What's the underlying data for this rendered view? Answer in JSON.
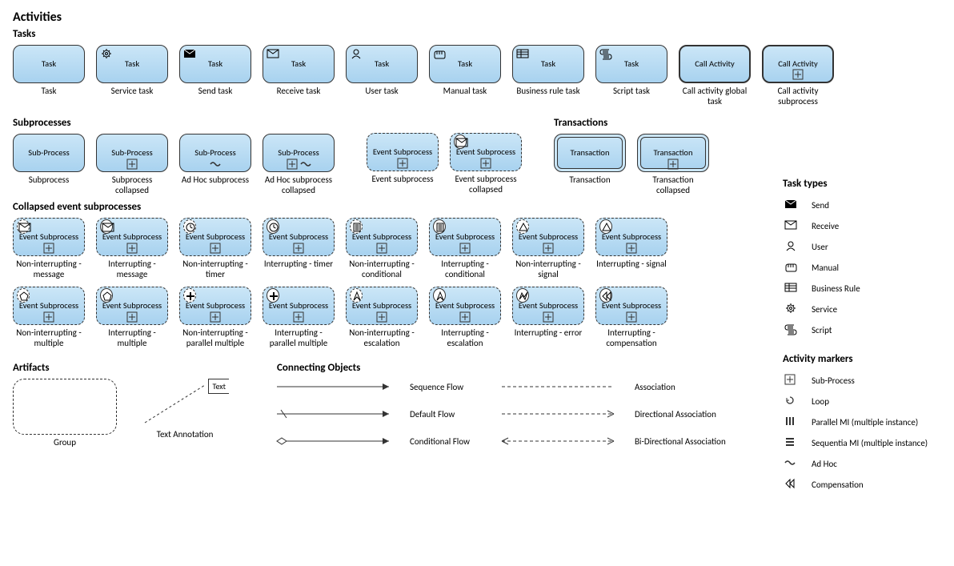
{
  "headings": {
    "activities": "Activities",
    "tasks": "Tasks",
    "subprocesses": "Subprocesses",
    "transactions": "Transactions",
    "collapsed": "Collapsed event subprocesses",
    "artifacts": "Artifacts",
    "connecting": "Connecting Objects",
    "task_types": "Task types",
    "activity_markers": "Activity markers"
  },
  "tasks": [
    {
      "label": "Task",
      "caption": "Task",
      "icon": null
    },
    {
      "label": "Task",
      "caption": "Service task",
      "icon": "gear"
    },
    {
      "label": "Task",
      "caption": "Send task",
      "icon": "send"
    },
    {
      "label": "Task",
      "caption": "Receive task",
      "icon": "receive"
    },
    {
      "label": "Task",
      "caption": "User task",
      "icon": "user"
    },
    {
      "label": "Task",
      "caption": "Manual task",
      "icon": "manual"
    },
    {
      "label": "Task",
      "caption": "Business rule task",
      "icon": "rule"
    },
    {
      "label": "Task",
      "caption": "Script task",
      "icon": "script"
    },
    {
      "label": "Call Activity",
      "caption": "Call activity global task",
      "icon": null,
      "thick": true
    },
    {
      "label": "Call Activity",
      "caption": "Call activity subprocess",
      "icon": null,
      "thick": true,
      "markers": [
        "plusbox"
      ]
    }
  ],
  "subprocesses": [
    {
      "label": "Sub-Process",
      "caption": "Subprocess"
    },
    {
      "label": "Sub-Process",
      "caption": "Subprocess collapsed",
      "markers": [
        "plusbox"
      ]
    },
    {
      "label": "Sub-Process",
      "caption": "Ad Hoc subprocess",
      "markers": [
        "tilde"
      ]
    },
    {
      "label": "Sub-Process",
      "caption": "Ad Hoc subprocess collapsed",
      "markers": [
        "plusbox",
        "tilde"
      ]
    }
  ],
  "event_subprocesses": [
    {
      "label": "Event Subprocess",
      "caption": "Event subprocess",
      "dashed": true,
      "markers": [
        "plusbox"
      ]
    },
    {
      "label": "Event Subprocess",
      "caption": "Event subprocess collapsed",
      "dashed": true,
      "markers": [
        "plusbox"
      ],
      "corner": {
        "shape": "receive",
        "circle": "solid"
      }
    }
  ],
  "transactions": [
    {
      "label": "Transaction",
      "caption": "Transaction",
      "double": true
    },
    {
      "label": "Transaction",
      "caption": "Transaction collapsed",
      "double": true,
      "markers": [
        "plusbox"
      ]
    }
  ],
  "collapsed_rows": [
    [
      {
        "caption": "Non-interrupting - message",
        "corner": {
          "shape": "receive",
          "circle": "dashed"
        }
      },
      {
        "caption": "Interrupting - message",
        "corner": {
          "shape": "receive",
          "circle": "solid"
        }
      },
      {
        "caption": "Non-interrupting - timer",
        "corner": {
          "shape": "clock",
          "circle": "dashed"
        }
      },
      {
        "caption": "Interrupting - timer",
        "corner": {
          "shape": "clock",
          "circle": "solid"
        }
      },
      {
        "caption": "Non-interrupting - conditional",
        "corner": {
          "shape": "cond",
          "circle": "dashed"
        }
      },
      {
        "caption": "Interrupting - conditional",
        "corner": {
          "shape": "cond",
          "circle": "solid"
        }
      },
      {
        "caption": "Non-interrupting - signal",
        "corner": {
          "shape": "signal",
          "circle": "dashed"
        }
      },
      {
        "caption": "Interrupting - signal",
        "corner": {
          "shape": "signal",
          "circle": "solid"
        }
      }
    ],
    [
      {
        "caption": "Non-interrupting - multiple",
        "corner": {
          "shape": "pent",
          "circle": "dashed"
        }
      },
      {
        "caption": "Interrupting - multiple",
        "corner": {
          "shape": "pent",
          "circle": "solid"
        }
      },
      {
        "caption": "Non-interrupting - parallel multiple",
        "corner": {
          "shape": "plus",
          "circle": "dashed"
        }
      },
      {
        "caption": "Interrupting - parallel multiple",
        "corner": {
          "shape": "plus",
          "circle": "solid"
        }
      },
      {
        "caption": "Non-interrupting - escalation",
        "corner": {
          "shape": "esc",
          "circle": "dashed"
        }
      },
      {
        "caption": "Interrupting - escalation",
        "corner": {
          "shape": "esc",
          "circle": "solid"
        }
      },
      {
        "caption": "Interrupting - error",
        "corner": {
          "shape": "error",
          "circle": "solid"
        }
      },
      {
        "caption": "Interrupting - compensation",
        "corner": {
          "shape": "comp",
          "circle": "solid"
        }
      }
    ]
  ],
  "collapsed_label": "Event Subprocess",
  "artifacts": {
    "group": "Group",
    "textann_label": "Text",
    "textann": "Text Annotation"
  },
  "connecting": [
    {
      "name": "Sequence Flow",
      "style": "seq"
    },
    {
      "name": "Default Flow",
      "style": "def"
    },
    {
      "name": "Conditional Flow",
      "style": "cond"
    }
  ],
  "connecting2": [
    {
      "name": "Association",
      "style": "assoc"
    },
    {
      "name": "Directional Association",
      "style": "dassoc"
    },
    {
      "name": "Bi-Directional Association",
      "style": "bidir"
    }
  ],
  "task_types": [
    {
      "icon": "send",
      "label": "Send"
    },
    {
      "icon": "receive",
      "label": "Receive"
    },
    {
      "icon": "user",
      "label": "User"
    },
    {
      "icon": "manual",
      "label": "Manual"
    },
    {
      "icon": "rule",
      "label": "Business Rule"
    },
    {
      "icon": "gear",
      "label": "Service"
    },
    {
      "icon": "script",
      "label": "Script"
    }
  ],
  "activity_markers": [
    {
      "icon": "plusbox",
      "label": "Sub-Process"
    },
    {
      "icon": "loop",
      "label": "Loop"
    },
    {
      "icon": "parmi",
      "label": "Parallel MI (multiple instance)"
    },
    {
      "icon": "seqmi",
      "label": "Sequentia MI (multiple instance)"
    },
    {
      "icon": "tilde",
      "label": "Ad Hoc"
    },
    {
      "icon": "comp",
      "label": "Compensation"
    }
  ]
}
